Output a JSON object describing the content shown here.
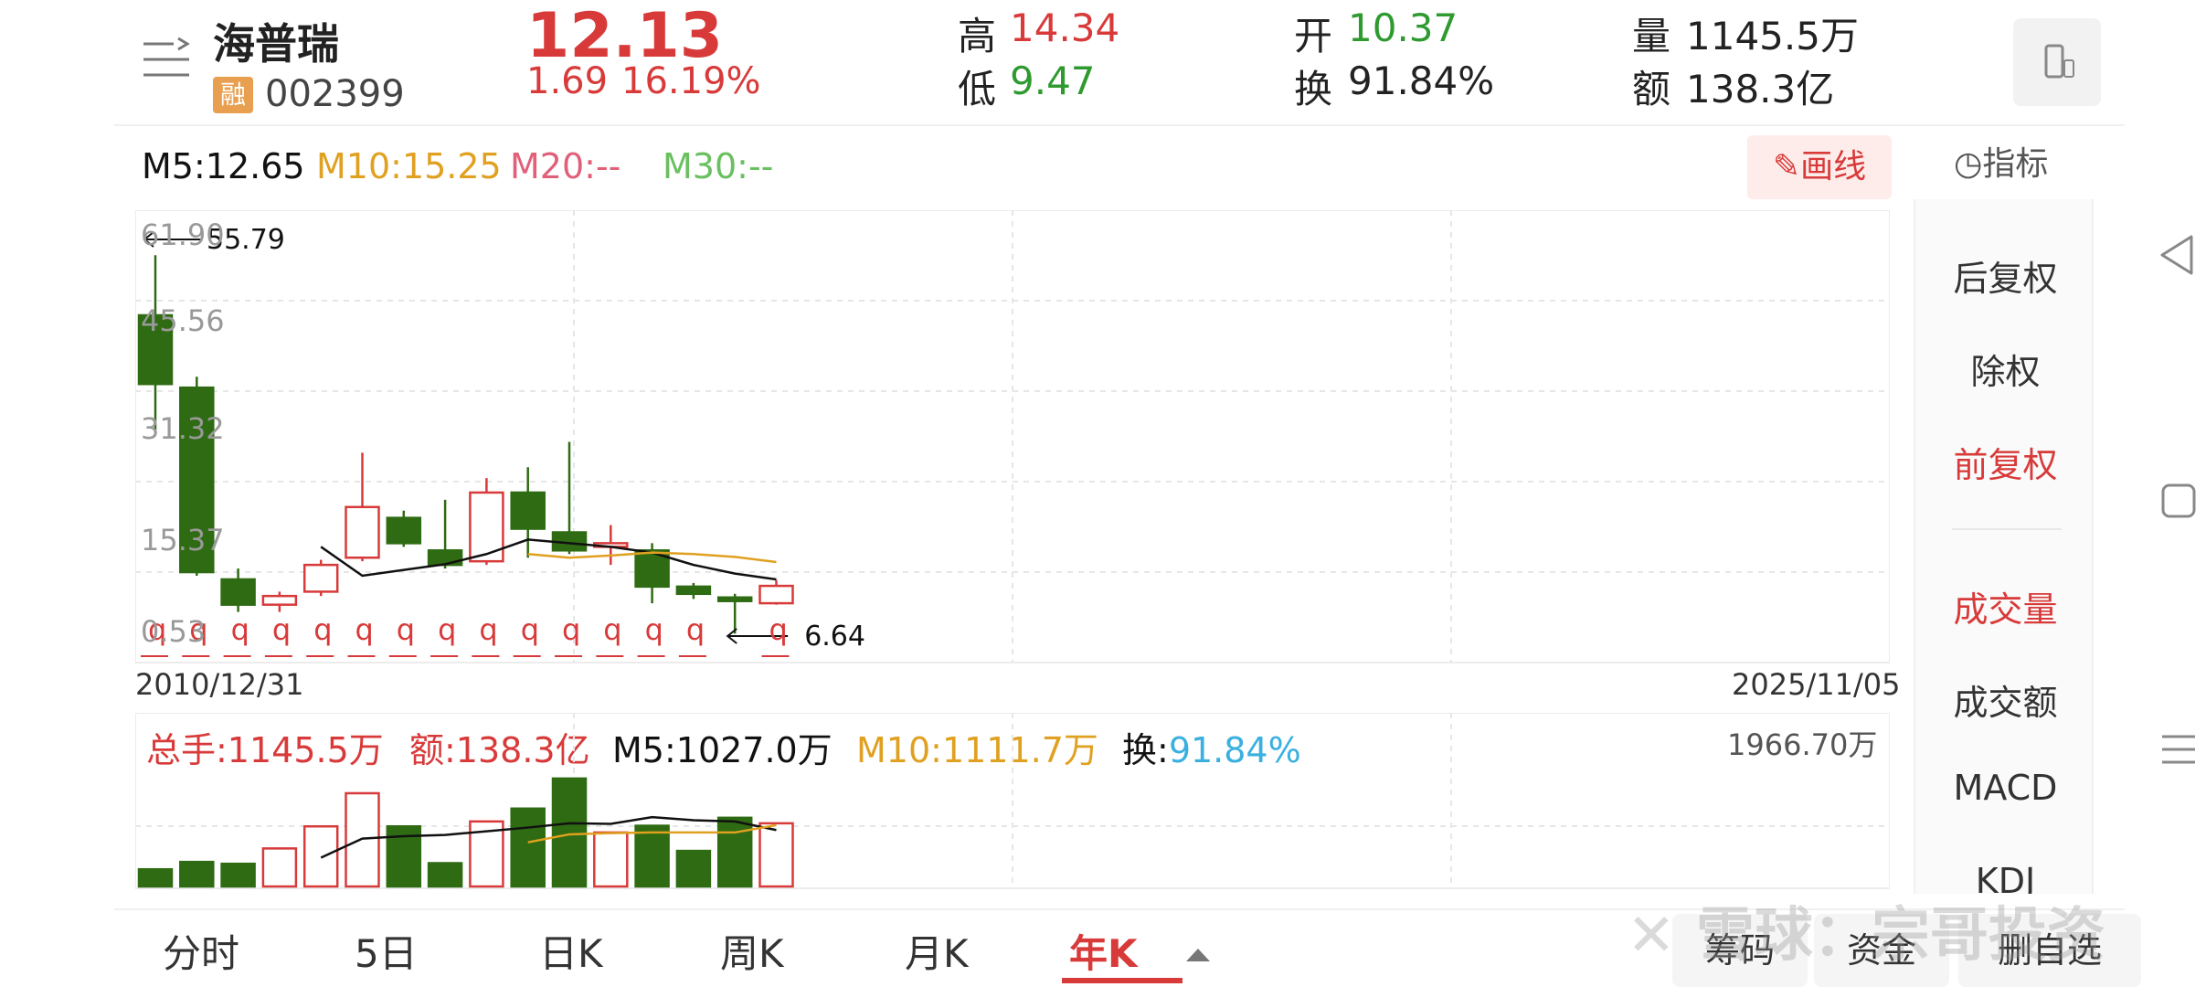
{
  "stock": {
    "name": "海普瑞",
    "code": "002399",
    "margin_badge": "融",
    "price": "12.13",
    "change": "1.69",
    "change_pct": "16.19%",
    "high_label": "高",
    "high": "14.34",
    "low_label": "低",
    "low": "9.47",
    "open_label": "开",
    "open": "10.37",
    "turnover_label": "换",
    "turnover": "91.84%",
    "volume_label": "量",
    "volume": "1145.5万",
    "amount_label": "额",
    "amount": "138.3亿"
  },
  "ma_bar": {
    "m5": "M5:12.65",
    "m10": "M10:15.25",
    "m20": "M20:--",
    "m30": "M30:--",
    "draw_button": "画线",
    "indicator_label": "指标"
  },
  "colors": {
    "up": "#d83a3a",
    "down": "#2e6b12",
    "m5": "#111111",
    "m10": "#e0a020",
    "m20": "#e0607a",
    "m30": "#6ac060"
  },
  "chart_data": {
    "type": "candlestick",
    "period": "年K",
    "y_ticks": [
      "61.90",
      "45.56",
      "31.32",
      "15.37",
      "0.53"
    ],
    "x_start": "2010/12/31",
    "x_end": "2025/11/05",
    "max_annotation": "55.79",
    "min_annotation": "6.64",
    "marker_glyph": "q",
    "candles": [
      {
        "o": 48.0,
        "c": 38.5,
        "h": 56.3,
        "l": 32.0
      },
      {
        "o": 38.0,
        "c": 12.5,
        "h": 39.5,
        "l": 12.0
      },
      {
        "o": 11.5,
        "c": 8.0,
        "h": 13.0,
        "l": 7.0
      },
      {
        "o": 8.0,
        "c": 9.2,
        "h": 9.8,
        "l": 7.0
      },
      {
        "o": 9.8,
        "c": 13.5,
        "h": 14.2,
        "l": 9.2
      },
      {
        "o": 14.5,
        "c": 21.5,
        "h": 29.0,
        "l": 14.0
      },
      {
        "o": 20.0,
        "c": 16.5,
        "h": 21.0,
        "l": 16.0
      },
      {
        "o": 15.5,
        "c": 13.5,
        "h": 22.5,
        "l": 13.0
      },
      {
        "o": 14.0,
        "c": 23.5,
        "h": 25.5,
        "l": 13.5
      },
      {
        "o": 23.5,
        "c": 18.5,
        "h": 27.0,
        "l": 14.5
      },
      {
        "o": 18.0,
        "c": 15.5,
        "h": 30.5,
        "l": 15.0
      },
      {
        "o": 16.0,
        "c": 16.5,
        "h": 19.0,
        "l": 13.5
      },
      {
        "o": 15.5,
        "c": 10.5,
        "h": 16.5,
        "l": 8.2
      },
      {
        "o": 10.5,
        "c": 9.5,
        "h": 11.0,
        "l": 8.8
      },
      {
        "o": 9.0,
        "c": 8.5,
        "h": 9.5,
        "l": 4.0
      },
      {
        "o": 8.2,
        "c": 10.6,
        "h": 11.4,
        "l": 8.0
      }
    ],
    "ma5": [
      null,
      null,
      null,
      null,
      16.0,
      12.0,
      12.8,
      13.6,
      15.0,
      17.0,
      16.5,
      16.0,
      15.2,
      13.5,
      12.3,
      11.5
    ],
    "ma10": [
      null,
      null,
      null,
      null,
      null,
      null,
      null,
      null,
      null,
      15.0,
      14.5,
      14.8,
      15.2,
      15.0,
      14.6,
      13.9
    ]
  },
  "volume_chart": {
    "total_label": "总手:1145.5万",
    "amount_label": "额:138.3亿",
    "m5_label": "M5:1027.0万",
    "m10_label": "M10:1111.7万",
    "turnover_prefix": "换:",
    "turnover_value": "91.84%",
    "max_label": "1966.70万",
    "bars": [
      {
        "v": 280,
        "up": false
      },
      {
        "v": 400,
        "up": false
      },
      {
        "v": 370,
        "up": false
      },
      {
        "v": 620,
        "up": true
      },
      {
        "v": 980,
        "up": true
      },
      {
        "v": 1520,
        "up": true
      },
      {
        "v": 980,
        "up": false
      },
      {
        "v": 380,
        "up": false
      },
      {
        "v": 1060,
        "up": true
      },
      {
        "v": 1270,
        "up": false
      },
      {
        "v": 1760,
        "up": false
      },
      {
        "v": 880,
        "up": true
      },
      {
        "v": 990,
        "up": false
      },
      {
        "v": 580,
        "up": false
      },
      {
        "v": 1120,
        "up": false
      },
      {
        "v": 1030,
        "up": true
      }
    ],
    "ma5": [
      null,
      null,
      null,
      null,
      470,
      780,
      820,
      840,
      900,
      960,
      1030,
      1020,
      1130,
      1080,
      1060,
      920
    ],
    "ma10": [
      null,
      null,
      null,
      null,
      null,
      null,
      null,
      null,
      null,
      720,
      850,
      870,
      880,
      880,
      880,
      1000
    ]
  },
  "sidebar": {
    "items": [
      {
        "label": "后复权",
        "active": false
      },
      {
        "label": "除权",
        "active": false
      },
      {
        "label": "前复权",
        "active": true
      },
      {
        "label": "成交量",
        "active": true
      },
      {
        "label": "成交额",
        "active": false
      },
      {
        "label": "MACD",
        "active": false
      },
      {
        "label": "KDJ",
        "active": false
      }
    ]
  },
  "tabs": [
    {
      "label": "分时",
      "active": false
    },
    {
      "label": "5日",
      "active": false
    },
    {
      "label": "日K",
      "active": false
    },
    {
      "label": "周K",
      "active": false
    },
    {
      "label": "月K",
      "active": false
    },
    {
      "label": "年K",
      "active": true
    }
  ],
  "bottom_buttons": [
    "筹码",
    "资金",
    "删自选"
  ],
  "watermark": "雪球：宗哥投资"
}
